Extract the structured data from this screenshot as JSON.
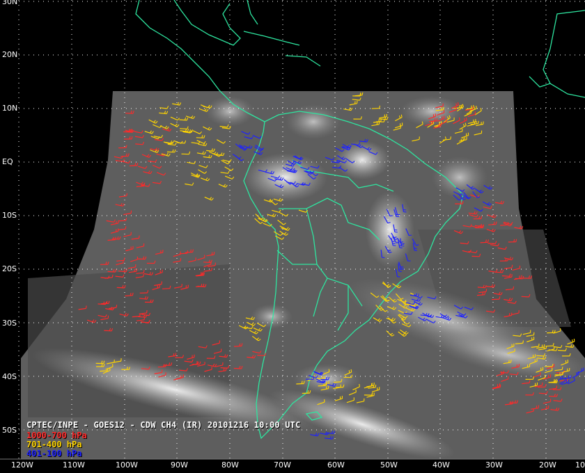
{
  "map": {
    "title": "CPTEC/INPE - GOES12 - CDW CH4 (IR) 20101216 10:00 UTC",
    "latitude_labels": [
      "30N",
      "20N",
      "10N",
      "EQ",
      "10S",
      "20S",
      "30S",
      "40S",
      "50S"
    ],
    "longitude_labels": [
      "120W",
      "110W",
      "100W",
      "90W",
      "80W",
      "70W",
      "60W",
      "50W",
      "40W",
      "30W",
      "20W",
      "10"
    ],
    "legend": [
      {
        "label": "1000-700 hPa",
        "color": "#ff2a2a"
      },
      {
        "label": "701-400 hPa",
        "color": "#ffd400"
      },
      {
        "label": "401-100 hPa",
        "color": "#1e22ff"
      }
    ],
    "coastline_color": "#2ee6a0",
    "grid_color": "#ffffff",
    "background_color": "#000000"
  }
}
